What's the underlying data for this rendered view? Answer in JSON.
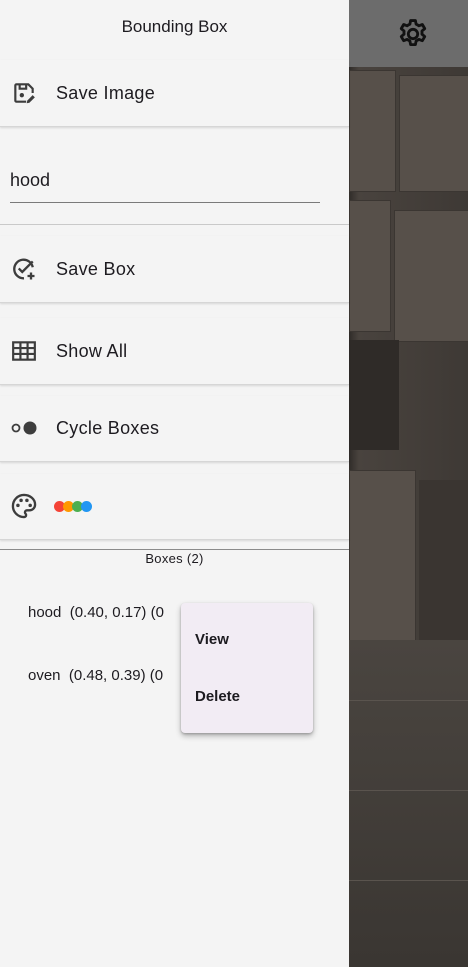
{
  "drawer": {
    "title": "Bounding Box",
    "save_image_label": "Save Image",
    "label_input_value": "hood",
    "save_box_label": "Save Box",
    "show_all_label": "Show All",
    "cycle_boxes_label": "Cycle Boxes",
    "palette_colors": [
      "#f44336",
      "#ff9800",
      "#4caf50",
      "#2196f3"
    ]
  },
  "boxes": {
    "title": "Boxes (2)",
    "items": [
      {
        "text": "hood  (0.40, 0.17) (0"
      },
      {
        "text": "oven  (0.48, 0.39) (0"
      }
    ]
  },
  "context_menu": {
    "items": [
      "View",
      "Delete"
    ]
  },
  "topbar": {
    "settings_icon": "gear-icon"
  }
}
